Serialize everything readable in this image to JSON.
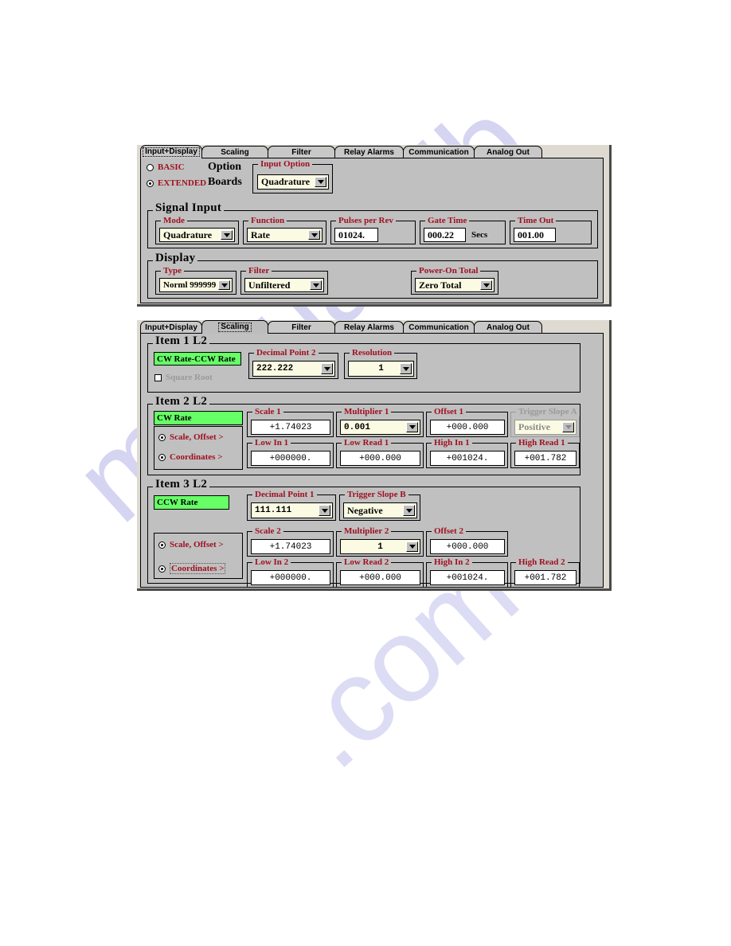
{
  "watermark": {
    "text1": "manualslib",
    "text2": ".com"
  },
  "panels": [
    {
      "id": "input-display",
      "tabs": [
        {
          "label": "Input+Display",
          "state": "selected"
        },
        {
          "label": "Scaling",
          "state": "normal"
        },
        {
          "label": "Filter",
          "state": "normal"
        },
        {
          "label": "Relay Alarms",
          "state": "normal"
        },
        {
          "label": "Communication",
          "state": "normal"
        },
        {
          "label": "Analog Out",
          "state": "normal"
        }
      ],
      "mode_radios": [
        {
          "label": "BASIC",
          "selected": false
        },
        {
          "label": "EXTENDED",
          "selected": true
        }
      ],
      "option_boards_label_line1": "Option",
      "option_boards_label_line2": "Boards",
      "input_option": {
        "legend": "Input Option",
        "value": "Quadrature"
      },
      "signal_input": {
        "legend": "Signal Input",
        "mode": {
          "legend": "Mode",
          "value": "Quadrature"
        },
        "function": {
          "legend": "Function",
          "value": "Rate"
        },
        "pulses_per_rev": {
          "legend": "Pulses per Rev",
          "value": "01024."
        },
        "gate_time": {
          "legend": "Gate Time",
          "value": "000.22",
          "units": "Secs"
        },
        "time_out": {
          "legend": "Time Out",
          "value": "001.00"
        }
      },
      "display": {
        "legend": "Display",
        "type": {
          "legend": "Type",
          "value": "Norml 999999"
        },
        "filter": {
          "legend": "Filter",
          "value": "Unfiltered"
        },
        "power_on_total": {
          "legend": "Power-On Total",
          "value": "Zero Total"
        }
      }
    },
    {
      "id": "scaling",
      "tabs": [
        {
          "label": "Input+Display",
          "state": "normal"
        },
        {
          "label": "Scaling",
          "state": "pressed"
        },
        {
          "label": "Filter",
          "state": "normal"
        },
        {
          "label": "Relay Alarms",
          "state": "normal"
        },
        {
          "label": "Communication",
          "state": "normal"
        },
        {
          "label": "Analog Out",
          "state": "normal"
        }
      ],
      "item1": {
        "legend": "Item 1  L2",
        "name": "CW Rate-CCW Rate",
        "square_root": {
          "label": "Square Root",
          "checked": false
        },
        "decimal_point": {
          "legend": "Decimal Point 2",
          "value": "222.222"
        },
        "resolution": {
          "legend": "Resolution",
          "value": "1"
        }
      },
      "item2": {
        "legend": "Item 2  L2",
        "name": "CW Rate",
        "radios": [
          {
            "label": "Scale, Offset  >",
            "selected": true
          },
          {
            "label": "Coordinates  >",
            "selected": true
          }
        ],
        "scale": {
          "legend": "Scale 1",
          "value": "+1.74023"
        },
        "multiplier": {
          "legend": "Multiplier 1",
          "value": "0.001"
        },
        "offset": {
          "legend": "Offset 1",
          "value": "+000.000"
        },
        "trigger_slope": {
          "legend": "Trigger Slope A",
          "value": "Positive",
          "disabled": true
        },
        "low_in": {
          "legend": "Low In 1",
          "value": "+000000."
        },
        "low_read": {
          "legend": "Low Read 1",
          "value": "+000.000"
        },
        "high_in": {
          "legend": "High In 1",
          "value": "+001024."
        },
        "high_read": {
          "legend": "High Read 1",
          "value": "+001.782"
        }
      },
      "item3": {
        "legend": "Item 3  L2",
        "name": "CCW Rate",
        "radios": [
          {
            "label": "Scale, Offset  >",
            "selected": true
          },
          {
            "label": "Coordinates  >",
            "selected": true
          }
        ],
        "decimal_point": {
          "legend": "Decimal Point 1",
          "value": "111.111"
        },
        "trigger_slope": {
          "legend": "Trigger Slope B",
          "value": "Negative"
        },
        "scale": {
          "legend": "Scale 2",
          "value": "+1.74023"
        },
        "multiplier": {
          "legend": "Multiplier 2",
          "value": "1"
        },
        "offset": {
          "legend": "Offset 2",
          "value": "+000.000"
        },
        "low_in": {
          "legend": "Low In 2",
          "value": "+000000."
        },
        "low_read": {
          "legend": "Low Read 2",
          "value": "+000.000"
        },
        "high_in": {
          "legend": "High In 2",
          "value": "+001024."
        },
        "high_read": {
          "legend": "High Read 2",
          "value": "+001.782"
        }
      }
    }
  ],
  "colors": {
    "legend_red": "#a01020",
    "green_label": "#66ff66",
    "dialog_gray": "#c0c0c0",
    "field_cream": "#fbfbe4",
    "watermark": "#d5d5f2"
  }
}
